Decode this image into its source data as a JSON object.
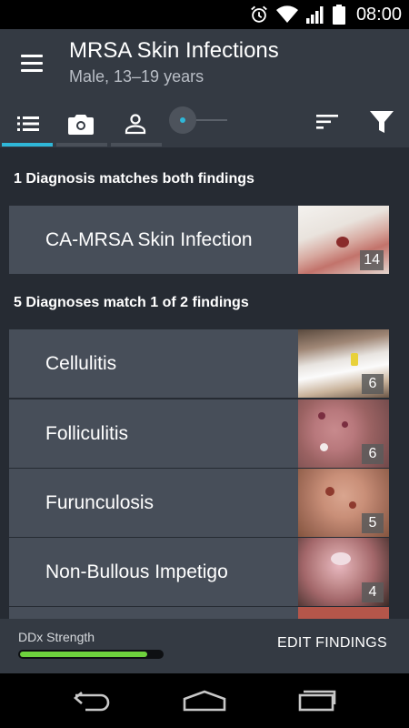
{
  "status_bar": {
    "time": "08:00"
  },
  "header": {
    "title": "MRSA Skin Infections",
    "subtitle": "Male, 13–19 years"
  },
  "tabs": [
    {
      "icon": "list-icon",
      "selected": true
    },
    {
      "icon": "camera-icon",
      "selected": false
    },
    {
      "icon": "person-icon",
      "selected": false
    }
  ],
  "toolbar": {
    "sort_icon": "sort-icon",
    "filter_icon": "filter-icon"
  },
  "sections": [
    {
      "heading": "1 Diagnosis matches both findings",
      "items": [
        {
          "name": "CA-MRSA Skin Infection",
          "count": "14"
        }
      ]
    },
    {
      "heading": "5 Diagnoses match 1 of 2 findings",
      "items": [
        {
          "name": "Cellulitis",
          "count": "6"
        },
        {
          "name": "Folliculitis",
          "count": "6"
        },
        {
          "name": "Furunculosis",
          "count": "5"
        },
        {
          "name": "Non-Bullous Impetigo",
          "count": "4"
        }
      ]
    }
  ],
  "bottom_bar": {
    "strength_label": "DDx Strength",
    "strength_value": 0.9,
    "strength_color": "#6ed23d",
    "edit_label": "EDIT FINDINGS"
  },
  "colors": {
    "accent": "#2fb7d8",
    "header_bg": "#343a43",
    "row_bg": "#474e59",
    "content_bg": "#262b33"
  }
}
